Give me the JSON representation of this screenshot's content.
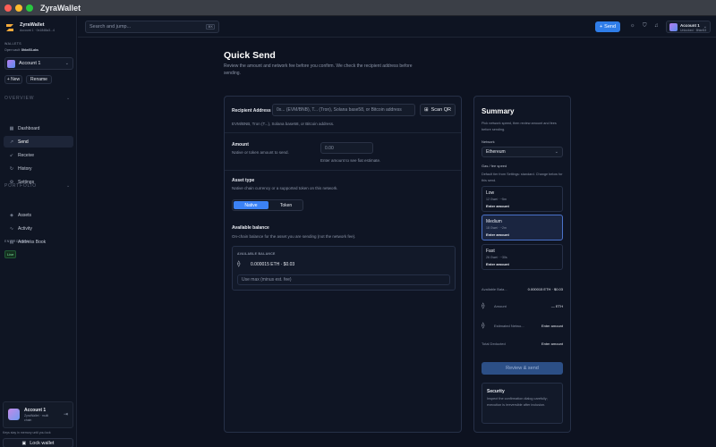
{
  "window": {
    "title": "ZyraWallet"
  },
  "sidebar": {
    "brand": "ZyraWallet",
    "brand_sub": "Account 1 · 0x1848a3...4",
    "wallets_label": "WALLETS",
    "wallet_open_prefix": "Open vault:",
    "wallet_open_name": "8hkn53-aks",
    "account_name": "Account 1",
    "new_label": "+ New",
    "rename_label": "Rename",
    "overview_label": "OVERVIEW",
    "overview_items": [
      {
        "label": "Dashboard",
        "icon": "grid-icon"
      },
      {
        "label": "Send",
        "icon": "send-icon"
      },
      {
        "label": "Receive",
        "icon": "receive-icon"
      },
      {
        "label": "History",
        "icon": "history-icon"
      },
      {
        "label": "Settings",
        "icon": "gear-icon"
      }
    ],
    "portfolio_label": "PORTFOLIO",
    "portfolio_items": [
      {
        "label": "Assets",
        "icon": "assets-icon"
      },
      {
        "label": "Activity",
        "icon": "activity-icon"
      },
      {
        "label": "Address Book",
        "icon": "book-icon"
      }
    ],
    "environment_label": "ENVIRONMENT",
    "environment_badge": "Live",
    "user_name": "Account 1",
    "user_sub": "ZyraWallet · multi chain",
    "keys_note": "Keys stay in memory until you lock",
    "lock_label": "Lock wallet"
  },
  "topbar": {
    "search_placeholder": "Search and jump...",
    "search_kbd": "⌘K",
    "send_label": "Send",
    "account_name": "Account 1",
    "account_sub": "Unlocked · 8hkn53"
  },
  "page": {
    "title": "Quick Send",
    "lead": "Review the amount and network fee before you confirm. We check the recipient address before sending."
  },
  "form": {
    "recipient_label": "Recipient Address",
    "recipient_placeholder": "0x... (EVM/BNB), T... (Tron), Solana base58, or Bitcoin address",
    "scan_label": "Scan QR",
    "recipient_help": "EVM/BNB, Tron (T...), Solana base58, or Bitcoin address.",
    "amount_label": "Amount",
    "amount_help": "Native or token amount to send.",
    "amount_placeholder": "0.00",
    "amount_note": "Enter amount to see fiat estimate.",
    "asset_type_label": "Asset type",
    "asset_type_help": "Native chain currency or a supported token on this network.",
    "asset_options": [
      "Native",
      "Token"
    ],
    "balance_label": "Available balance",
    "balance_help": "On-chain balance for the asset you are sending (not the network fee).",
    "balance_box_header": "AVAILABLE BALANCE",
    "balance_value": "0.000015 ETH · $0.03",
    "use_max": "Use max (minus est. fee)"
  },
  "summary": {
    "title": "Summary",
    "lead": "Pick network speed, then review amount and fees before sending.",
    "network_label": "Network",
    "network_value": "Ethereum",
    "fee_label": "Gas / fee speed",
    "fee_help": "Default tier from Settings: standard. Change below for this send.",
    "tiers": [
      {
        "name": "Low",
        "sub": "12 Gwei · ~5m",
        "amount": "Enter amount"
      },
      {
        "name": "Medium",
        "sub": "18 Gwei · ~2m",
        "amount": "Enter amount"
      },
      {
        "name": "Fast",
        "sub": "26 Gwei · ~30s",
        "amount": "Enter amount"
      }
    ],
    "available_label": "Available Bala...",
    "available_value": "0.000015 ETH · $0.03",
    "amount_label": "Amount",
    "amount_value": "— ETH",
    "est_label": "Estimated Netwo...",
    "est_value": "Enter amount",
    "total_label": "Total Deducted",
    "total_value": "Enter amount",
    "review_label": "Review & send",
    "security_title": "Security",
    "security_text": "Inspect the confirmation dialog carefully; execution is irreversible after inclusion."
  }
}
